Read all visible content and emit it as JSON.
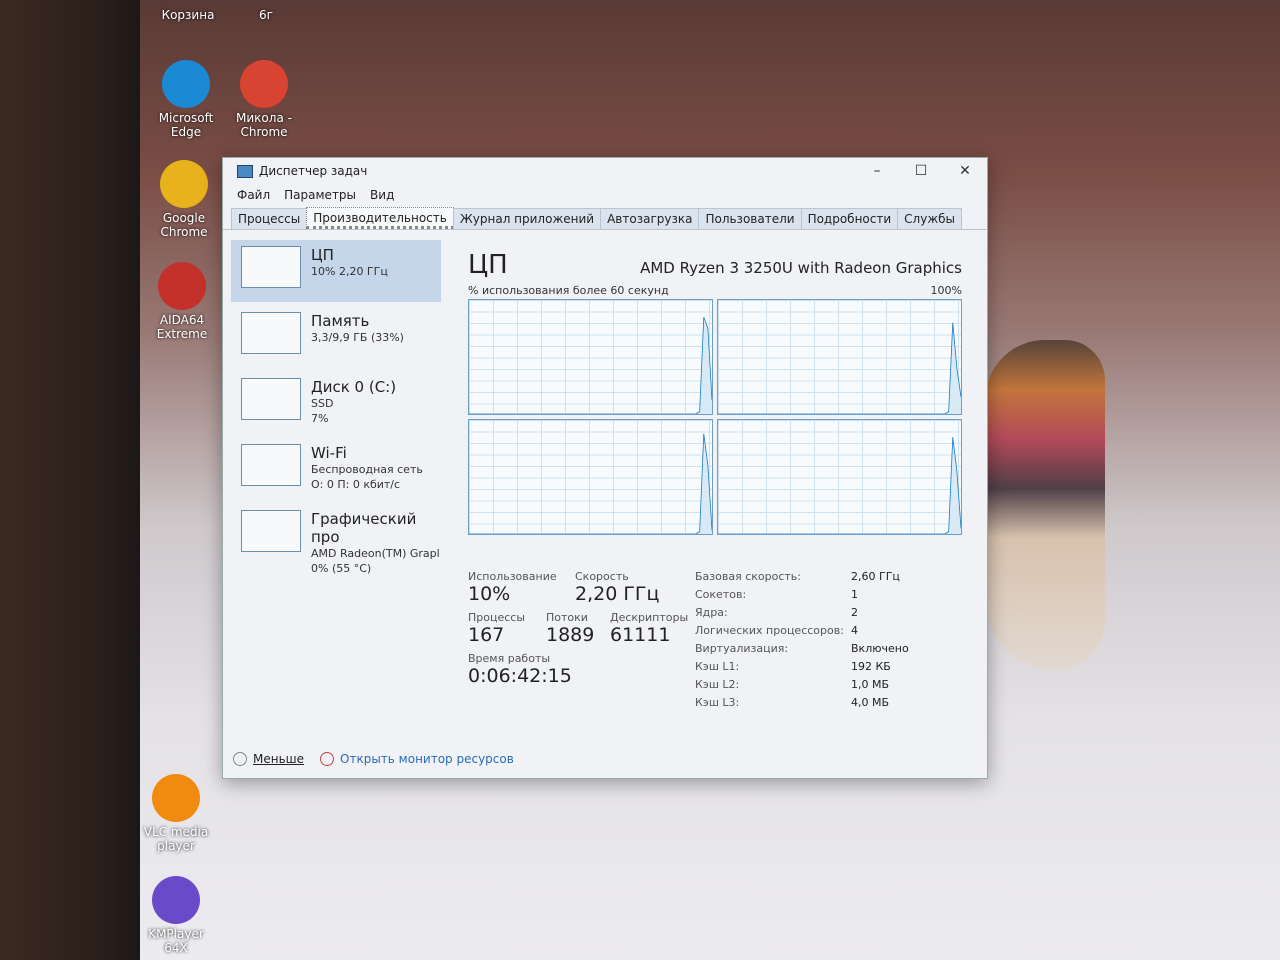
{
  "desktop": {
    "icons": [
      {
        "label": "Корзина",
        "color": "#8aa"
      },
      {
        "label": "6г",
        "color": "#ccc"
      },
      {
        "label": "Microsoft Edge",
        "color": "#1a8ad4"
      },
      {
        "label": "Микола - Chrome",
        "color": "#d84332"
      },
      {
        "label": "Google Chrome",
        "color": "#e8b21c"
      },
      {
        "label": "AIDA64 Extreme",
        "color": "#c4302a"
      },
      {
        "label": "VLC media player",
        "color": "#f08a10"
      },
      {
        "label": "KMPlayer 64X",
        "color": "#6a4ac8"
      }
    ]
  },
  "window": {
    "title": "Диспетчер задач",
    "controls": {
      "minimize": "–",
      "maximize": "☐",
      "close": "✕"
    }
  },
  "menu": [
    "Файл",
    "Параметры",
    "Вид"
  ],
  "tabs": [
    {
      "label": "Процессы"
    },
    {
      "label": "Производительность",
      "active": true
    },
    {
      "label": "Журнал приложений"
    },
    {
      "label": "Автозагрузка"
    },
    {
      "label": "Пользователи"
    },
    {
      "label": "Подробности"
    },
    {
      "label": "Службы"
    }
  ],
  "sidebar": [
    {
      "name": "ЦП",
      "line1": "10% 2,20 ГГц",
      "line2": "",
      "selected": true
    },
    {
      "name": "Память",
      "line1": "3,3/9,9 ГБ (33%)",
      "line2": ""
    },
    {
      "name": "Диск 0 (C:)",
      "line1": "SSD",
      "line2": "7%"
    },
    {
      "name": "Wi-Fi",
      "line1": "Беспроводная сеть",
      "line2": "О: 0 П: 0 кбит/с"
    },
    {
      "name": "Графический про",
      "line1": "AMD Radeon(TM) Grapl",
      "line2": "0% (55 °C)"
    }
  ],
  "cpu": {
    "title": "ЦП",
    "model": "AMD Ryzen 3 3250U with Radeon Graphics",
    "graph_label": "% использования более 60 секунд",
    "graph_max": "100%",
    "core_history": [
      [
        0,
        0,
        0,
        0,
        0,
        0,
        0,
        0,
        0,
        0,
        0,
        0,
        0,
        0,
        0,
        0,
        0,
        0,
        0,
        0,
        0,
        0,
        0,
        0,
        0,
        0,
        0,
        0,
        0,
        0,
        0,
        0,
        0,
        0,
        0,
        0,
        0,
        0,
        0,
        0,
        0,
        0,
        0,
        0,
        0,
        0,
        0,
        0,
        0,
        0,
        0,
        0,
        0,
        0,
        0,
        0,
        2,
        85,
        75,
        12
      ],
      [
        0,
        0,
        0,
        0,
        0,
        0,
        0,
        0,
        0,
        0,
        0,
        0,
        0,
        0,
        0,
        0,
        0,
        0,
        0,
        0,
        0,
        0,
        0,
        0,
        0,
        0,
        0,
        0,
        0,
        0,
        0,
        0,
        0,
        0,
        0,
        0,
        0,
        0,
        0,
        0,
        0,
        0,
        0,
        0,
        0,
        0,
        0,
        0,
        0,
        0,
        0,
        0,
        0,
        0,
        0,
        0,
        2,
        80,
        40,
        15
      ],
      [
        0,
        0,
        0,
        0,
        0,
        0,
        0,
        0,
        0,
        0,
        0,
        0,
        0,
        0,
        0,
        0,
        0,
        0,
        0,
        0,
        0,
        0,
        0,
        0,
        0,
        0,
        0,
        0,
        0,
        0,
        0,
        0,
        0,
        0,
        0,
        0,
        0,
        0,
        0,
        0,
        0,
        0,
        0,
        0,
        0,
        0,
        0,
        0,
        0,
        0,
        0,
        0,
        0,
        0,
        0,
        0,
        2,
        88,
        60,
        3
      ],
      [
        0,
        0,
        0,
        0,
        0,
        0,
        0,
        0,
        0,
        0,
        0,
        0,
        0,
        0,
        0,
        0,
        0,
        0,
        0,
        0,
        0,
        0,
        0,
        0,
        0,
        0,
        0,
        0,
        0,
        0,
        0,
        0,
        0,
        0,
        0,
        0,
        0,
        0,
        0,
        0,
        0,
        0,
        0,
        0,
        0,
        0,
        0,
        0,
        0,
        0,
        0,
        0,
        0,
        0,
        0,
        0,
        2,
        85,
        55,
        5
      ]
    ],
    "usage_label": "Использование",
    "usage": "10%",
    "speed_label": "Скорость",
    "speed": "2,20 ГГц",
    "processes_label": "Процессы",
    "processes": "167",
    "threads_label": "Потоки",
    "threads": "1889",
    "handles_label": "Дескрипторы",
    "handles": "61111",
    "uptime_label": "Время работы",
    "uptime": "0:06:42:15",
    "specs": [
      {
        "k": "Базовая скорость:",
        "v": "2,60 ГГц"
      },
      {
        "k": "Сокетов:",
        "v": "1"
      },
      {
        "k": "Ядра:",
        "v": "2"
      },
      {
        "k": "Логических процессоров:",
        "v": "4"
      },
      {
        "k": "Виртуализация:",
        "v": "Включено"
      },
      {
        "k": "Кэш L1:",
        "v": "192 КБ"
      },
      {
        "k": "Кэш L2:",
        "v": "1,0 МБ"
      },
      {
        "k": "Кэш L3:",
        "v": "4,0 МБ"
      }
    ]
  },
  "footer": {
    "less": "Меньше",
    "monitor": "Открыть монитор ресурсов"
  }
}
